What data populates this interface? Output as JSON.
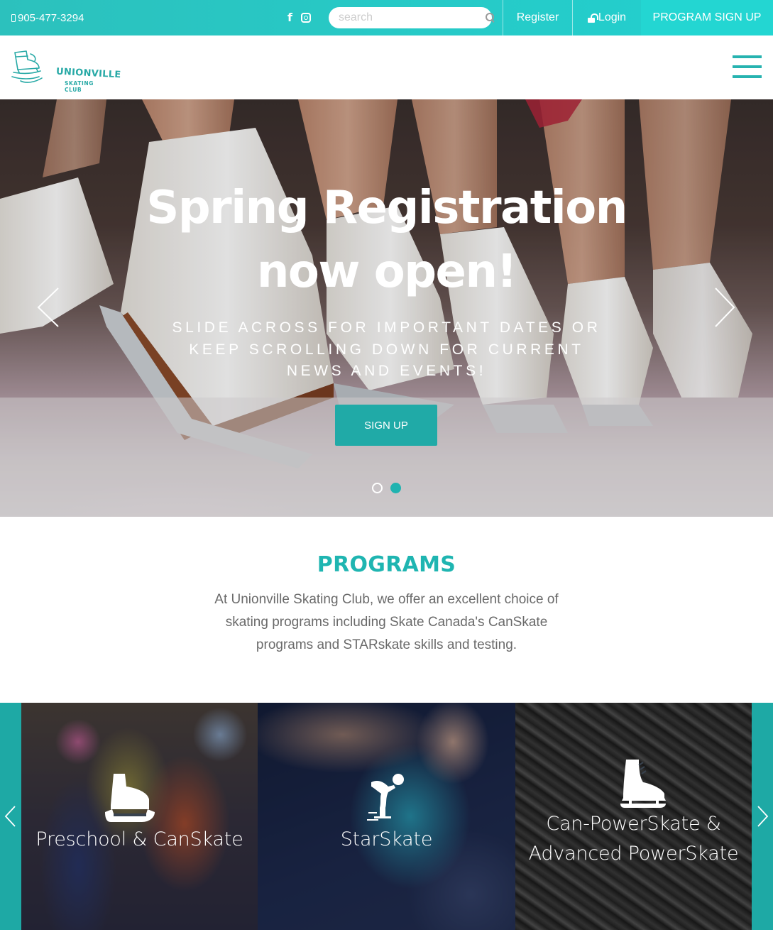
{
  "topbar": {
    "phone": "905-477-3294",
    "icons": [
      "phone-icon",
      "facebook-icon",
      "instagram-icon",
      "search-icon",
      "lock-icon"
    ],
    "search_placeholder": "search",
    "register_label": "Register",
    "login_label": "Login",
    "program_signup_label": "PROGRAM SIGN UP"
  },
  "header": {
    "logo_name": "UNIONVILLE",
    "logo_sub": "SKATING CLUB",
    "menu_icon": "hamburger-icon"
  },
  "hero": {
    "title_line1": "Spring Registration",
    "title_line2": "now open!",
    "subtitle": "SLIDE ACROSS FOR IMPORTANT DATES OR KEEP SCROLLING DOWN FOR CURRENT NEWS AND EVENTS!",
    "button_label": "SIGN UP",
    "slide_count": 2,
    "active_slide": 2
  },
  "programs": {
    "title": "PROGRAMS",
    "description": "At Unionville Skating Club, we offer an excellent choice of skating programs including Skate Canada's CanSkate programs and STARskate skills and testing.",
    "cards": [
      {
        "label": "Preschool & CanSkate",
        "icon": "figure-skate-icon"
      },
      {
        "label": "StarSkate",
        "icon": "skater-icon"
      },
      {
        "label": "Can-PowerSkate & Advanced PowerSkate",
        "icon": "hockey-skate-icon"
      }
    ]
  },
  "colors": {
    "accent": "#20aaa7",
    "topbar": "#27c9c6",
    "signup_tab": "#23d6d2",
    "programs_title": "#1fb5b1"
  }
}
